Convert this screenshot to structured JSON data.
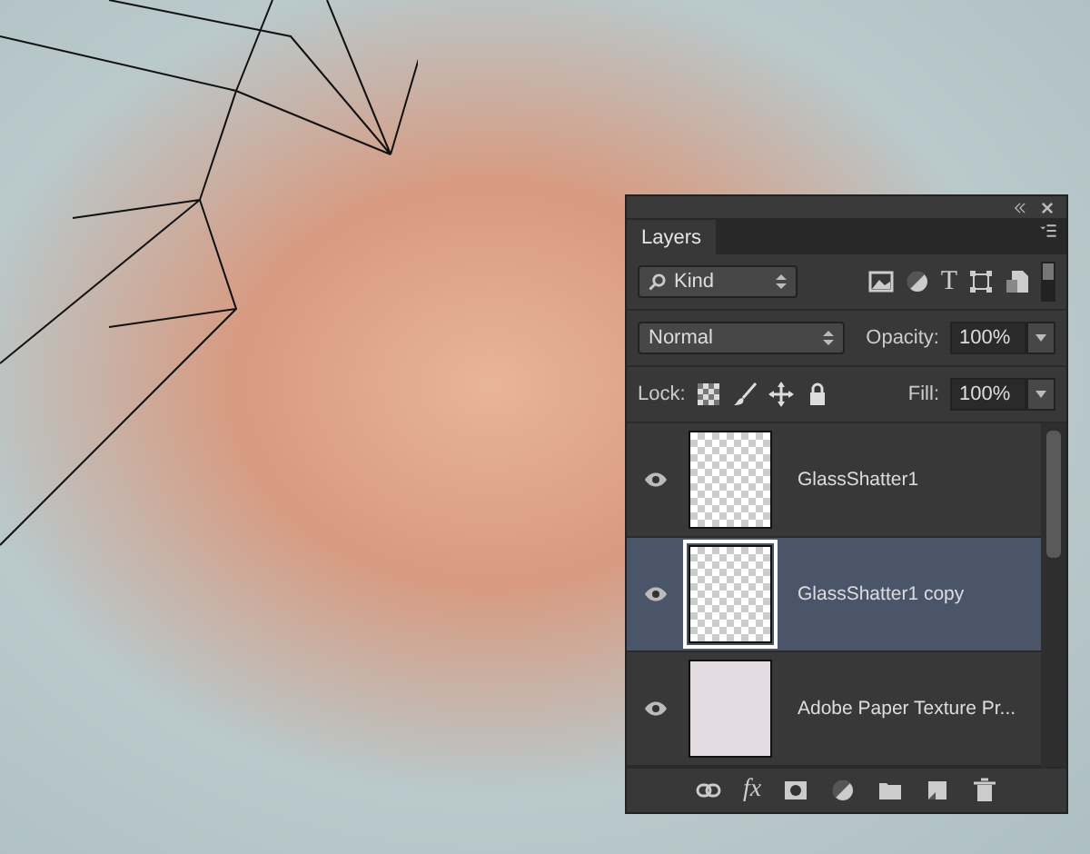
{
  "panel": {
    "tab": {
      "label": "Layers",
      "selected": true
    },
    "filter": {
      "value": "Kind",
      "type_filter_label": "T"
    },
    "blend_mode": {
      "value": "Normal"
    },
    "opacity": {
      "label": "Opacity:",
      "value": "100%"
    },
    "lock": {
      "label": "Lock:"
    },
    "fill": {
      "label": "Fill:",
      "value": "100%"
    },
    "layers": [
      {
        "name": "GlassShatter1",
        "kind": "shatter",
        "visible": true,
        "selected": false
      },
      {
        "name": "GlassShatter1 copy",
        "kind": "shatter",
        "visible": true,
        "selected": true
      },
      {
        "name": "Adobe Paper Texture Pr...",
        "kind": "texture",
        "visible": true,
        "selected": false
      }
    ],
    "footer": {
      "effects_label": "fx"
    }
  }
}
